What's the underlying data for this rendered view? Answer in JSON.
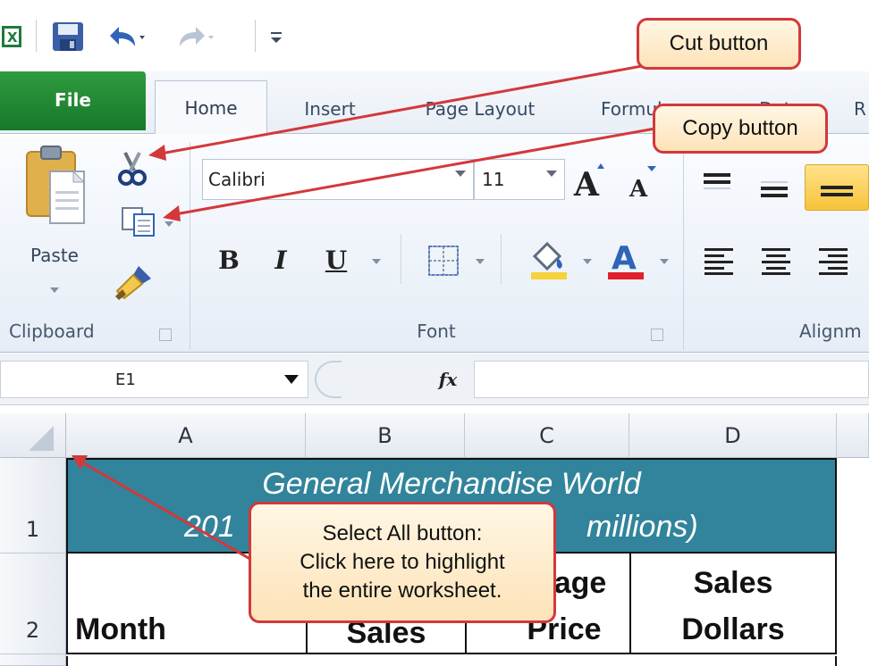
{
  "tabs": {
    "file": "File",
    "home": "Home",
    "insert": "Insert",
    "page_layout": "Page Layout",
    "formulas": "Formulas",
    "data": "Data",
    "review": "R"
  },
  "clipboard": {
    "paste_label": "Paste",
    "group_label": "Clipboard"
  },
  "font": {
    "font_name": "Calibri",
    "font_size": "11",
    "bold": "B",
    "italic": "I",
    "underline": "U",
    "group_label": "Font"
  },
  "alignment": {
    "group_label": "Alignm"
  },
  "formula_bar": {
    "name_box": "E1",
    "fx": "fx"
  },
  "columns": [
    "A",
    "B",
    "C",
    "D"
  ],
  "rows": [
    "1",
    "2"
  ],
  "sheet": {
    "title_line1": "General Merchandise World",
    "title_line2_left": "201",
    "title_line2_right": "millions)",
    "col_a": "Month",
    "col_b": "Sales",
    "col_c_top": "age",
    "col_c_bottom": "Price",
    "col_d_top": "Sales",
    "col_d_bottom": "Dollars"
  },
  "callouts": {
    "cut": "Cut button",
    "copy": "Copy button",
    "select_all_1": "Select All button:",
    "select_all_2": "Click here to highlight",
    "select_all_3": "the entire worksheet."
  },
  "colors": {
    "file_tab": "#1f8a34",
    "title_fill": "#31849b",
    "callout_border": "#d3383b",
    "highlight_yellow": "#f6d23c",
    "font_color_red": "#e0202a"
  }
}
